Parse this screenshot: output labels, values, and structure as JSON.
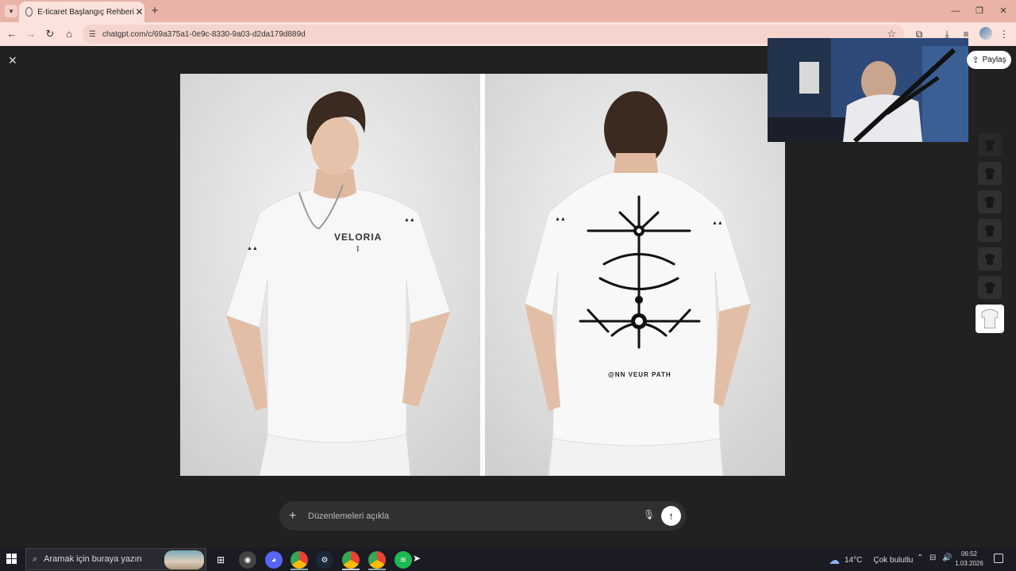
{
  "browser": {
    "tab_title": "E-ticaret Başlangıç Rehberi",
    "tab_close": "✕",
    "new_tab": "+",
    "url": "chatgpt.com/c/69a375a1-0e9c-8330-9a03-d2da179d889d",
    "window_minimize": "—",
    "window_restore": "❐",
    "window_close": "✕"
  },
  "viewer": {
    "close": "✕",
    "share_label": "Paylaş",
    "front_logo": "VELORIA",
    "front_logo_sub": "I",
    "back_print_text": "@NN VEUR PATH"
  },
  "composer": {
    "placeholder": "Düzenlemeleri açıkla",
    "plus": "+",
    "send": "↑"
  },
  "taskbar": {
    "search_placeholder": "Aramak için buraya yazın",
    "weather_temp": "14°C",
    "weather_condition": "Çok bulutlu",
    "time": "06:52",
    "date": "1.03.2026"
  },
  "colors": {
    "tab_strip": "#e9b3a7",
    "toolbar": "#fbe2dc",
    "viewer_bg": "#212121",
    "composer_bg": "#303030",
    "taskbar_bg": "#1b1b24"
  }
}
